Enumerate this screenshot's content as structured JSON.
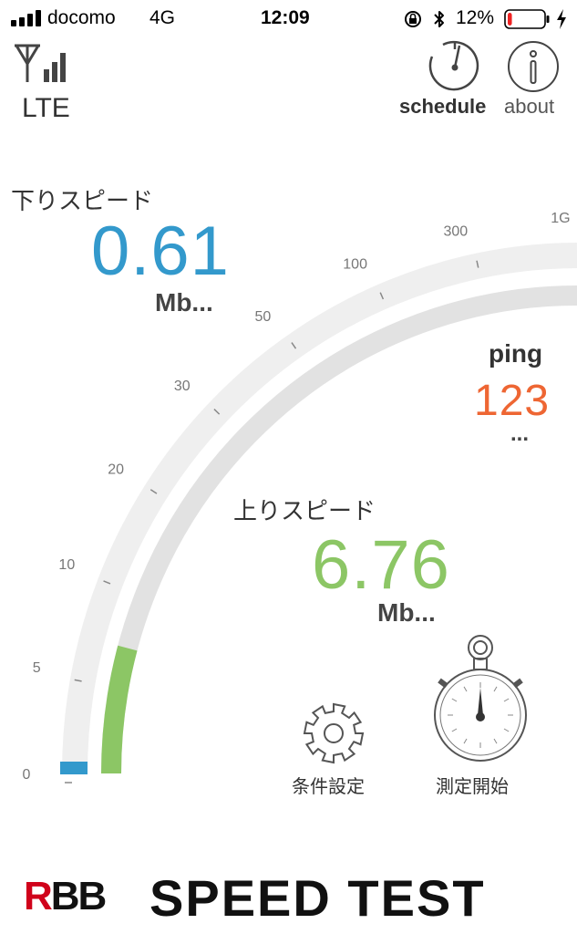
{
  "status_bar": {
    "carrier": "docomo",
    "network": "4G",
    "time": "12:09",
    "battery_percent": "12%",
    "battery_level": 0.12
  },
  "header": {
    "network_type": "LTE",
    "schedule_label": "schedule",
    "about_label": "about"
  },
  "download": {
    "title": "下りスピード",
    "value": "0.61",
    "unit": "Mb...",
    "color": "#3399cc"
  },
  "ping": {
    "title": "ping",
    "value": "123",
    "unit": "...",
    "color": "#ee6633"
  },
  "upload": {
    "title": "上りスピード",
    "value": "6.76",
    "unit": "Mb...",
    "color": "#8cc665"
  },
  "gauge": {
    "scale_labels": [
      "0",
      "5",
      "10",
      "20",
      "30",
      "50",
      "100",
      "300",
      "1G"
    ],
    "download_mbps": 0.61,
    "upload_mbps": 6.76
  },
  "buttons": {
    "settings_label": "条件設定",
    "start_label": "測定開始"
  },
  "branding": {
    "rbb": "RBB",
    "product": "SPEED TEST"
  }
}
